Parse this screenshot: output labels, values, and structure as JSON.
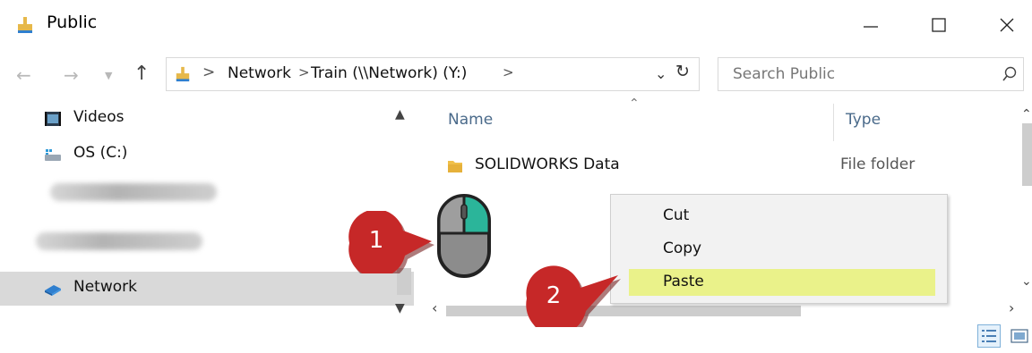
{
  "window": {
    "title": "Public",
    "icons": {
      "title": "folder-user-icon",
      "minimize": "minimize-icon",
      "maximize": "maximize-icon",
      "close": "close-icon"
    }
  },
  "navigation": {
    "back_icon": "arrow-left-icon",
    "forward_icon": "arrow-right-icon",
    "recent_icon": "chevron-down-icon",
    "up_icon": "arrow-up-icon"
  },
  "address": {
    "separator": ">",
    "crumbs": [
      "Network",
      "Train (\\\\Network) (Y:)"
    ],
    "dropdown_icon": "chevron-down-icon",
    "refresh_icon": "refresh-icon"
  },
  "search": {
    "placeholder": "Search Public",
    "icon": "search-icon"
  },
  "sidebar": {
    "items": [
      {
        "label": "Videos",
        "icon": "videos-icon"
      },
      {
        "label": "OS (C:)",
        "icon": "drive-icon"
      },
      {
        "label": "Network",
        "icon": "network-icon",
        "selected": true
      }
    ],
    "blurred_items": 2
  },
  "content": {
    "columns": {
      "name": "Name",
      "type": "Type"
    },
    "rows": [
      {
        "name": "SOLIDWORKS Data",
        "type": "File folder",
        "icon": "folder-icon"
      }
    ]
  },
  "context_menu": {
    "items": [
      {
        "label": "Cut"
      },
      {
        "label": "Copy"
      },
      {
        "label": "Paste",
        "highlighted": true
      }
    ],
    "highlight_color": "#eaf28a"
  },
  "callouts": [
    {
      "number": "1",
      "color": "#c62828"
    },
    {
      "number": "2",
      "color": "#c62828"
    }
  ],
  "mouse": {
    "icon": "mouse-right-click-icon",
    "highlight_color": "#2bb59a"
  },
  "view": {
    "details_icon": "details-view-icon",
    "large_icons_icon": "large-icons-view-icon"
  }
}
